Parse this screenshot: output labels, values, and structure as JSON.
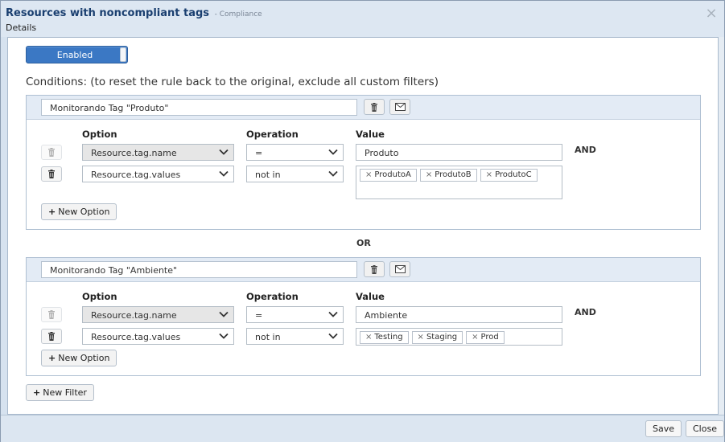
{
  "dialog": {
    "title": "Resources with noncompliant tags",
    "subtitle": "- Compliance",
    "tab": "Details",
    "close_icon": "×"
  },
  "toggle": {
    "label": "Enabled",
    "state": "on"
  },
  "conditions": {
    "label": "Conditions: (to reset the rule back to the original, exclude all custom filters)"
  },
  "columns": {
    "option": "Option",
    "operation": "Operation",
    "value": "Value"
  },
  "filters": [
    {
      "name": "Monitorando Tag \"Produto\"",
      "rows": [
        {
          "option": "Resource.tag.name",
          "operation": "=",
          "value": "Produto",
          "connector": "AND",
          "delete_disabled": true
        },
        {
          "option": "Resource.tag.values",
          "operation": "not in",
          "tags": [
            "ProdutoA",
            "ProdutoB",
            "ProdutoC"
          ],
          "delete_disabled": false
        }
      ],
      "new_option": "New Option"
    },
    {
      "name": "Monitorando Tag \"Ambiente\"",
      "rows": [
        {
          "option": "Resource.tag.name",
          "operation": "=",
          "value": "Ambiente",
          "connector": "AND",
          "delete_disabled": true
        },
        {
          "option": "Resource.tag.values",
          "operation": "not in",
          "tags": [
            "Testing",
            "Staging",
            "Prod"
          ],
          "delete_disabled": false
        }
      ],
      "new_option": "New Option"
    }
  ],
  "between_filters": "OR",
  "new_filter": "New Filter",
  "footer": {
    "save": "Save",
    "close": "Close"
  },
  "icons": {
    "delete": "trash-icon",
    "email": "envelope-icon",
    "dropdown": "chevron-down-icon",
    "add": "plus-icon",
    "remove_tag": "×"
  }
}
